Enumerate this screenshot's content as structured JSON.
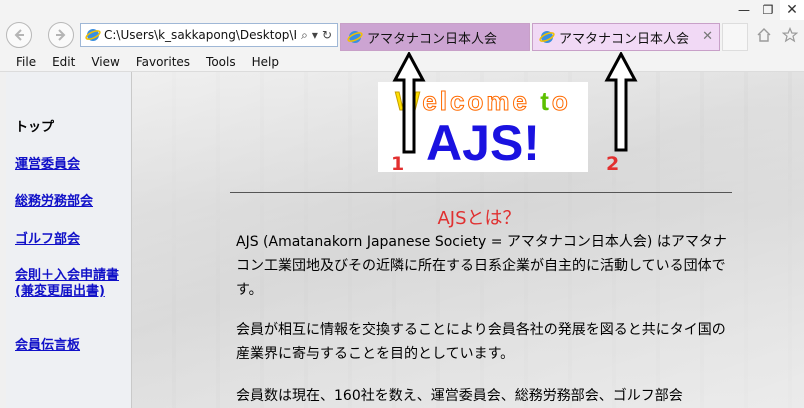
{
  "window": {
    "minimize_glyph": "—",
    "restore_glyph": "❐",
    "close_glyph": "✕"
  },
  "toolbar": {
    "address": "C:\\Users\\k_sakkapong\\Desktop\\H",
    "search_glyph": "⌕",
    "dropdown_glyph": "▾",
    "refresh_glyph": "↻"
  },
  "tabs": [
    {
      "label": "アマタナコン日本人会",
      "active": true
    },
    {
      "label": "アマタナコン日本人会",
      "active": false,
      "close_glyph": "✕"
    }
  ],
  "menu": {
    "file": "File",
    "edit": "Edit",
    "view": "View",
    "favorites": "Favorites",
    "tools": "Tools",
    "help": "Help"
  },
  "sidebar": {
    "items": [
      {
        "label": "トップ",
        "link": false
      },
      {
        "label": "運営委員会",
        "link": true
      },
      {
        "label": "総務労務部会",
        "link": true
      },
      {
        "label": "ゴルフ部会",
        "link": true
      },
      {
        "label": "会則＋入会申請書(兼変更届出書)",
        "link": true
      },
      {
        "label": "会員伝言板",
        "link": true
      }
    ]
  },
  "banner": {
    "welcome_parts": [
      "W",
      "e",
      "l",
      "c",
      "o",
      "m",
      "e",
      " ",
      "t",
      "o"
    ],
    "title": "AJS!"
  },
  "annotations": {
    "label1": "1",
    "label2": "2"
  },
  "article": {
    "heading": "AJSとは？",
    "p1": "AJS (Amatanakorn Japanese Society = アマタナコン日本人会) はアマタナコン工業団地及びその近隣に所在する日系企業が自主的に活動している団体です。",
    "p2": "会員が相互に情報を交換することにより会員各社の発展を図ると共にタイ国の産業界に寄与することを目的としています。",
    "p3": "会員数は現在、160社を数え、運営委員会、総務労務部会、ゴルフ部会"
  },
  "colors": {
    "link": "#1010c8",
    "heading": "#e03030",
    "annotation": "#e23030",
    "ajs_blue": "#1a12e0",
    "tab_active": "#cca4d2",
    "tab_inactive": "#f1d9f5"
  }
}
